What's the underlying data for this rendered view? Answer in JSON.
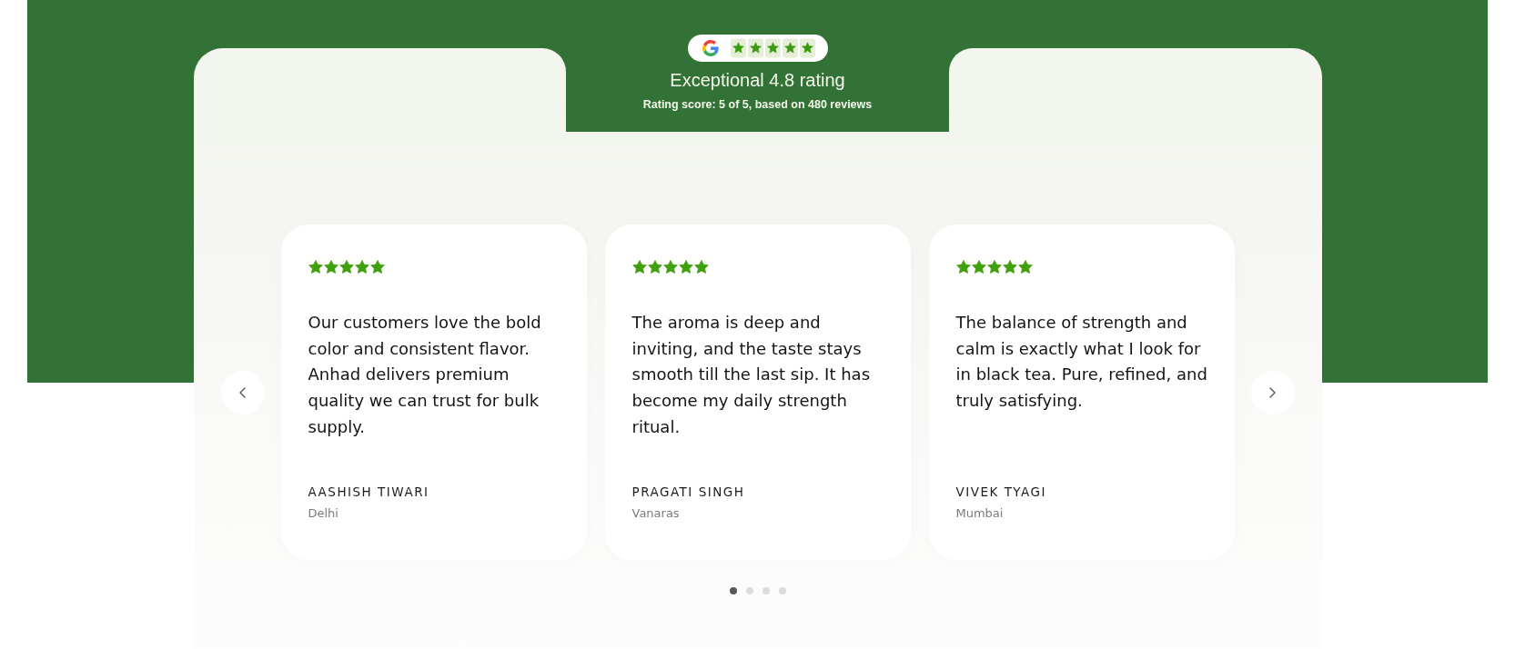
{
  "rating": {
    "stars": 5,
    "title": "Exceptional 4.8 rating",
    "summary": "Rating score: 5 of 5, based on 480 reviews"
  },
  "reviews": [
    {
      "stars": 5,
      "text": "Our customers love the bold color and consistent flavor. Anhad delivers premium quality we can trust for bulk supply.",
      "name": "AASHISH TIWARI",
      "location": "Delhi"
    },
    {
      "stars": 5,
      "text": "The aroma is deep and inviting, and the taste stays smooth till the last sip. It has become my daily strength ritual.",
      "name": "PRAGATI SINGH",
      "location": "Vanaras"
    },
    {
      "stars": 5,
      "text": "The balance of strength and calm is exactly what I look for in black tea. Pure, refined, and truly satisfying.",
      "name": "VIVEK TYAGI",
      "location": "Mumbai"
    }
  ],
  "pagination": [
    {
      "selected": true
    },
    {
      "selected": false
    },
    {
      "selected": false
    },
    {
      "selected": false
    }
  ]
}
